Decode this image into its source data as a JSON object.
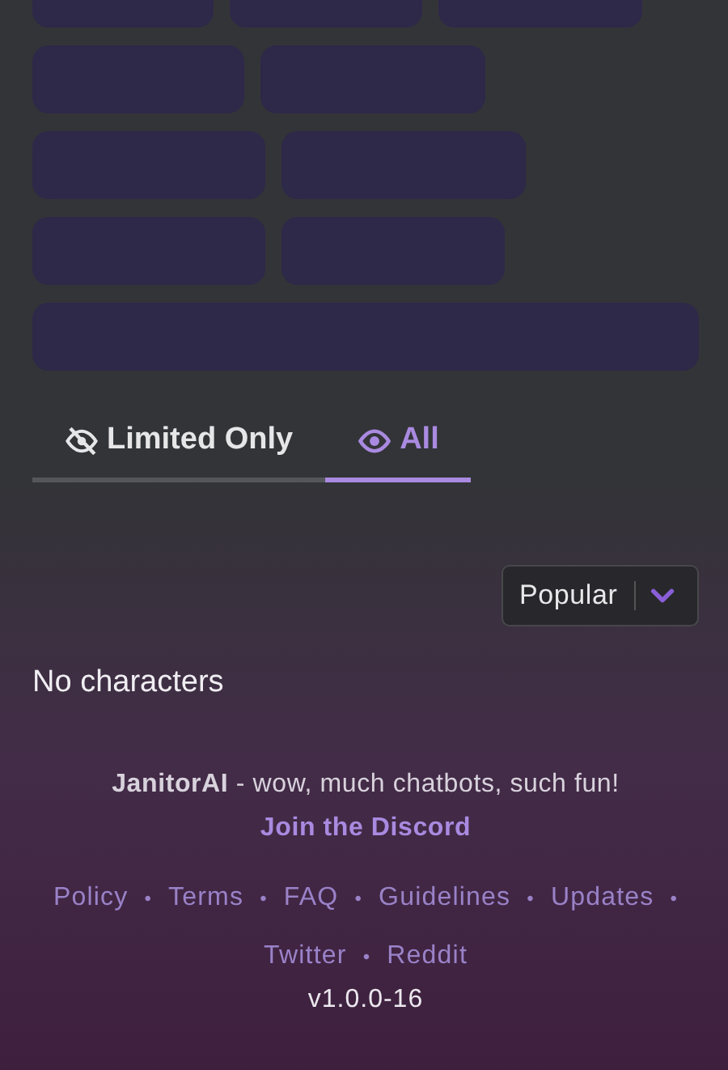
{
  "tabs": [
    {
      "label": "Limited Only",
      "kind": "hidden",
      "selected": false
    },
    {
      "label": "All",
      "kind": "visible",
      "selected": true
    }
  ],
  "sort": {
    "value": "Popular"
  },
  "empty_message": "No characters",
  "footer": {
    "tagline": "**JanitorAI** - wow, much chatbots, such fun!",
    "tagline_link": "Join the Discord",
    "separator": "•",
    "links": [
      "Policy",
      "Terms",
      "FAQ",
      "Guidelines",
      "Updates",
      "Twitter",
      "Reddit"
    ],
    "version": "v1.0.0-16"
  }
}
